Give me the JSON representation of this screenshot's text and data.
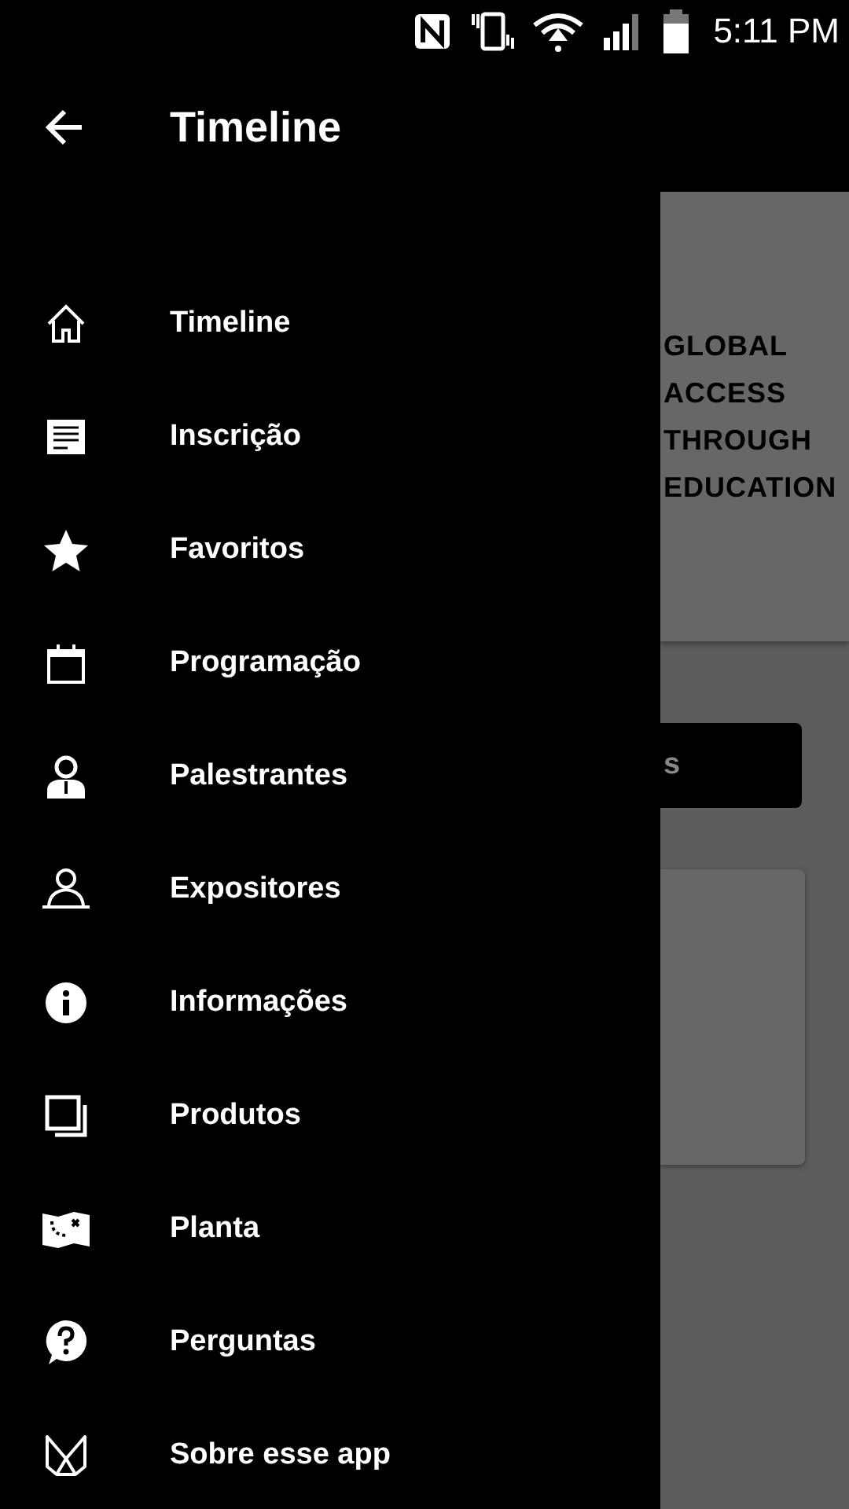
{
  "status_bar": {
    "time": "5:11 PM"
  },
  "drawer": {
    "title": "Timeline",
    "items": [
      {
        "kind": "home",
        "label": "Timeline"
      },
      {
        "kind": "document",
        "label": "Inscrição"
      },
      {
        "kind": "star",
        "label": "Favoritos"
      },
      {
        "kind": "calendar",
        "label": "Programação"
      },
      {
        "kind": "speaker",
        "label": "Palestrantes"
      },
      {
        "kind": "exhibitor",
        "label": "Expositores"
      },
      {
        "kind": "info",
        "label": "Informações"
      },
      {
        "kind": "products",
        "label": "Produtos"
      },
      {
        "kind": "map",
        "label": "Planta"
      },
      {
        "kind": "question",
        "label": "Perguntas"
      },
      {
        "kind": "about",
        "label": "Sobre esse app"
      }
    ]
  },
  "background": {
    "banner_lines": [
      "GLOBAL",
      "ACCESS",
      "THROUGH",
      "EDUCATION"
    ],
    "button_label": "s"
  }
}
